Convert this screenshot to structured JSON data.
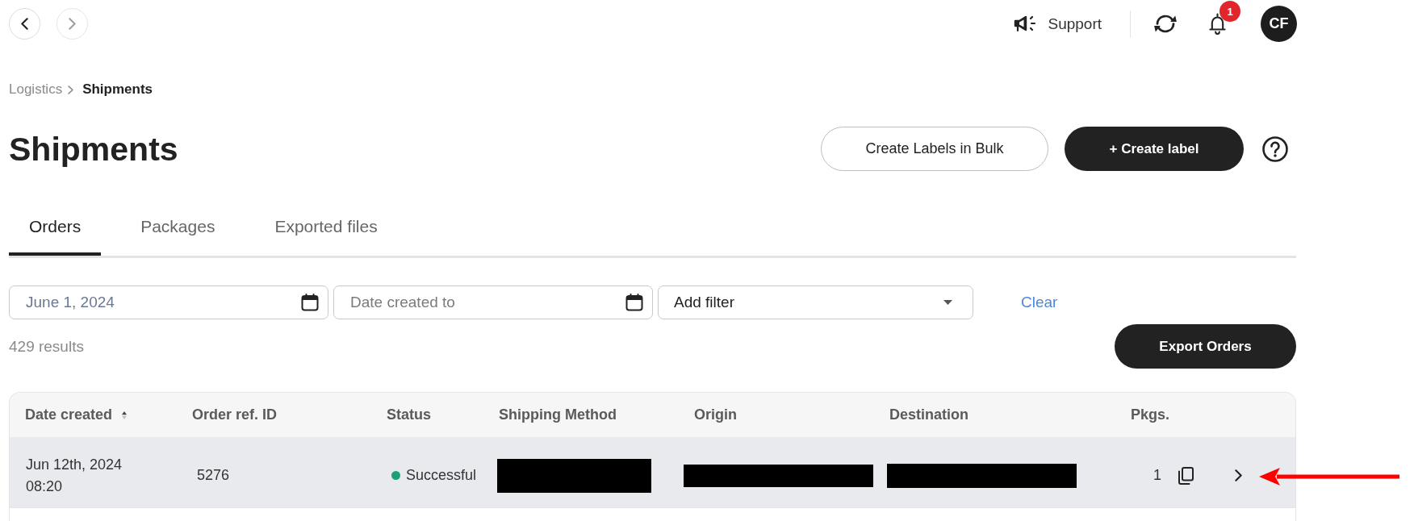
{
  "topbar": {
    "nav": [
      {
        "kind": "back",
        "disabled": false
      },
      {
        "kind": "forward",
        "disabled": true
      }
    ],
    "support": {
      "label": "Support"
    },
    "notifications": {
      "badge": "1"
    },
    "avatar": {
      "initials": "CF"
    }
  },
  "breadcrumb": [
    {
      "label": "Logistics",
      "current": false
    },
    {
      "label": "Shipments",
      "current": true
    }
  ],
  "header": {
    "title": "Shipments",
    "actions": [
      {
        "label": "Create Labels in Bulk",
        "kind": "outline"
      },
      {
        "label": "+ Create label",
        "kind": "filled"
      }
    ]
  },
  "tabs": [
    {
      "label": "Orders",
      "selected": true
    },
    {
      "label": "Packages",
      "selected": false
    },
    {
      "label": "Exported files",
      "selected": false
    }
  ],
  "filters": {
    "fields": [
      {
        "kind": "date",
        "value": "June 1, 2024"
      },
      {
        "kind": "date",
        "placeholder": "Date created to"
      },
      {
        "kind": "select",
        "value": "Add filter"
      }
    ],
    "clear": "Clear"
  },
  "results": {
    "count": "429 results",
    "export_button": "Export Orders"
  },
  "table": {
    "columns": [
      {
        "label": "Date created",
        "sorted": true
      },
      {
        "label": "Order ref. ID",
        "sorted": false
      },
      {
        "label": "Status",
        "sorted": false
      },
      {
        "label": "Shipping Method",
        "sorted": false
      },
      {
        "label": "Origin",
        "sorted": false
      },
      {
        "label": "Destination",
        "sorted": false
      },
      {
        "label": "Pkgs.",
        "sorted": false
      }
    ],
    "rows": [
      {
        "highlighted": true,
        "cells": [
          {
            "kind": "datetime",
            "date": "Jun 12th, 2024",
            "time": "08:20"
          },
          {
            "kind": "text",
            "text": "5276"
          },
          {
            "kind": "status",
            "label": "Successful",
            "color": "#1e9e7a"
          },
          {
            "kind": "redacted"
          },
          {
            "kind": "redacted"
          },
          {
            "kind": "redacted"
          },
          {
            "kind": "count",
            "text": "1"
          }
        ]
      }
    ]
  },
  "annotations": [
    {
      "kind": "arrow"
    }
  ]
}
